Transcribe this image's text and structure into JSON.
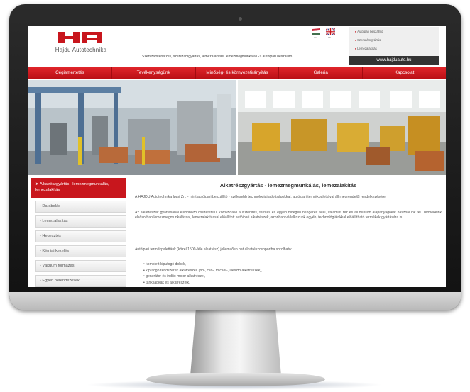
{
  "header": {
    "brand_name": "Hajdu Autotechnika",
    "logo_text": "HA",
    "tagline": "Szerszámtervezés, szerszámgyártás, lemezalakítás, lemezmegmunkálás -> autóipari beszállító",
    "flags": [
      {
        "label": "HU",
        "icon": "hungarian-flag-icon"
      },
      {
        "label": "EN",
        "icon": "english-flag-icon"
      }
    ],
    "quicklinks": [
      "Autóipari beszállító",
      "Szerszámgyártás",
      "Lemezalakítás"
    ],
    "url": "www.hajduauto.hu"
  },
  "nav": {
    "items": [
      "Cégismertetés",
      "Tevékenységünk",
      "Minőség- és környezetirányítás",
      "Galéria",
      "Kapcsolat"
    ]
  },
  "sidebar": {
    "active": "Alkatrészgyártás - lemezmegmunkálás, lemezalakítás",
    "items": [
      "Darabolás",
      "Lemezalakítás",
      "Hegesztés",
      "Kémiai kezelés",
      "Vákuum formázás",
      "Egyéb berendezések"
    ]
  },
  "content": {
    "title": "Alkatrészgyártás - lemezmegmunkálás, lemezalakítás",
    "paragraph_1": "A HAJDU Autotechnika Ipari Zrt. - mint autóipari beszállító - szélesebb technológiai adottságokkal, autóipari termékpalettával áll megrendelői rendelkezésére.",
    "paragraph_2": "Az alkatrészek gyártásánál különböző összetételű, korrózióálló ausztenites, ferrites és egyéb hidegen hengerelt acél, valamint réz és alumínium alapanyagokat használunk fel. Termékeink elsősorban lemezmegmunkálással, lemezalakítással előállított autóipari alkatrészek, azonban vállalkozunk egyéb, technológiáinkkal előállítható termékek gyártására is.",
    "paragraph_3": "Autóipari termékpalettánk (közel 1500-féle alkatrész) jellemzően hat alkatrészcsoportba sorolható:",
    "list": [
      "komplett kipufogó dobok,",
      "kipufogó rendszerek alkatrészei, (hő-, cső-, tölcsér-, illesztő alkatrészek),",
      "generátor és indító motor alkatrészei,",
      "tanksapkák és alkatrészeik,"
    ]
  },
  "colors": {
    "brand_red": "#c8161d",
    "nav_red": "#d81e24",
    "url_bar": "#333333"
  }
}
